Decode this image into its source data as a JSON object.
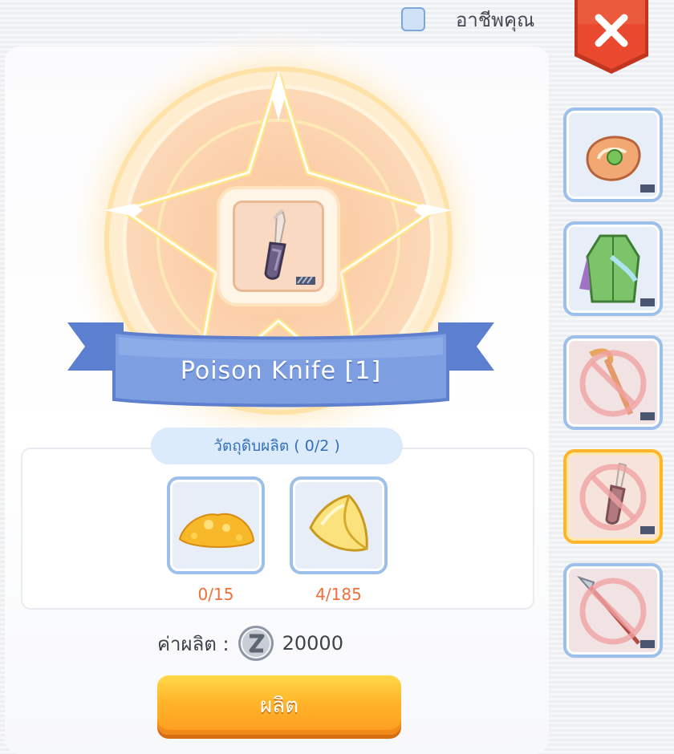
{
  "filter": {
    "label": "อาชีพคุณ",
    "checked": false
  },
  "close_button": {
    "icon": "close-icon",
    "color": "#e8492f"
  },
  "item": {
    "name": "Poison Knife [1]",
    "icon": "knife-icon"
  },
  "materials": {
    "header": "วัตถุดิบผลิต ( 0/2 )",
    "items": [
      {
        "icon": "gold-powder-icon",
        "count": "0/15"
      },
      {
        "icon": "yellow-gemstone-icon",
        "count": "4/185"
      }
    ]
  },
  "cost": {
    "label": "ค่าผลิต :",
    "currency_icon": "zeny-coin-icon",
    "value": "20000"
  },
  "craft_button": {
    "label": "ผลิต"
  },
  "side_items": [
    {
      "icon": "bracelet-icon",
      "state": "available"
    },
    {
      "icon": "green-robe-icon",
      "state": "available"
    },
    {
      "icon": "staff-icon",
      "state": "locked"
    },
    {
      "icon": "knife-icon",
      "state": "selected-locked"
    },
    {
      "icon": "spear-icon",
      "state": "locked"
    }
  ],
  "colors": {
    "accent": "#ffb52a",
    "ribbon": "#6f92d8",
    "count_text": "#f0703a",
    "header_text": "#356fb9"
  }
}
